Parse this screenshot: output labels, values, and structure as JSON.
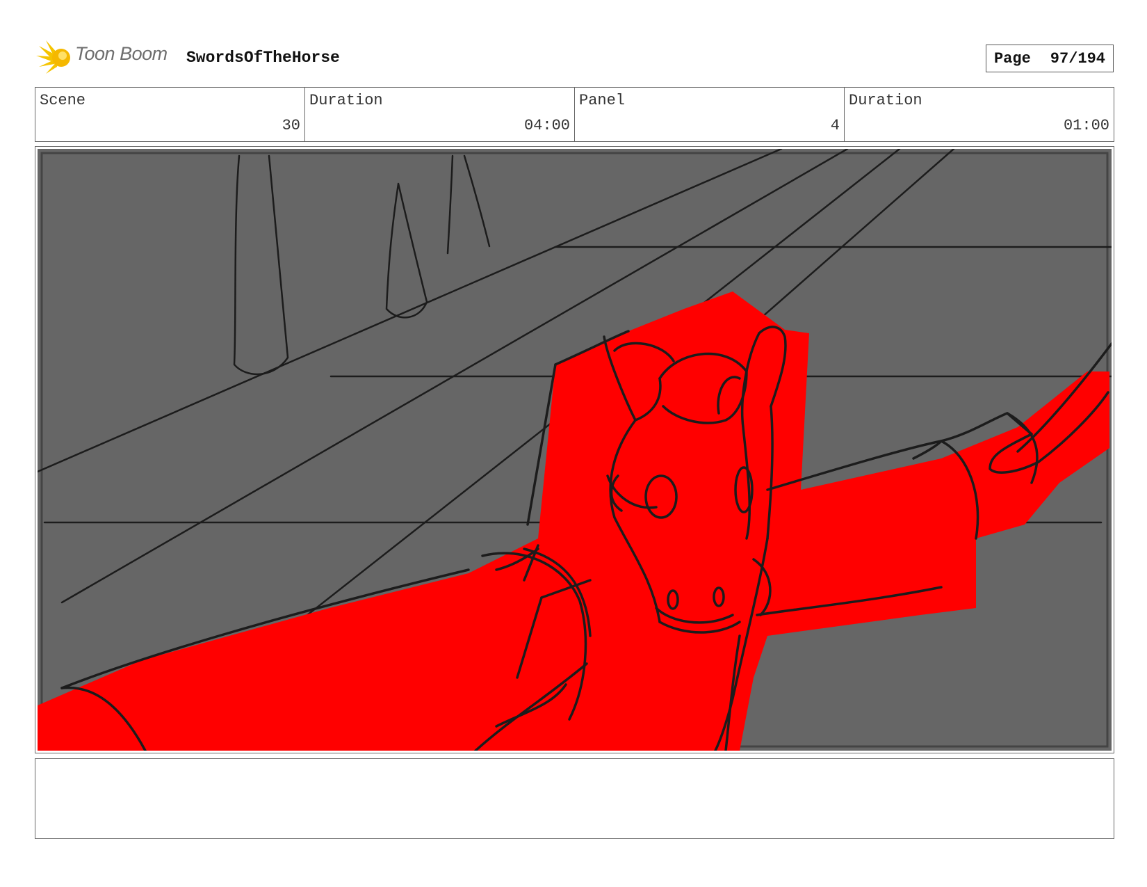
{
  "header": {
    "logo_text": "Toon Boom",
    "project_title": "SwordsOfTheHorse",
    "page_label": "Page",
    "page_number": "97/194"
  },
  "info": {
    "scene_label": "Scene",
    "scene_value": "30",
    "scene_duration_label": "Duration",
    "scene_duration_value": "04:00",
    "panel_label": "Panel",
    "panel_value": "4",
    "panel_duration_label": "Duration",
    "panel_duration_value": "01:00"
  },
  "colors": {
    "background_gray": "#666666",
    "figure_red": "#ff0000",
    "line_ink": "#1c1c1c",
    "logo_yellow": "#f5c400"
  },
  "notes": {
    "text": ""
  }
}
